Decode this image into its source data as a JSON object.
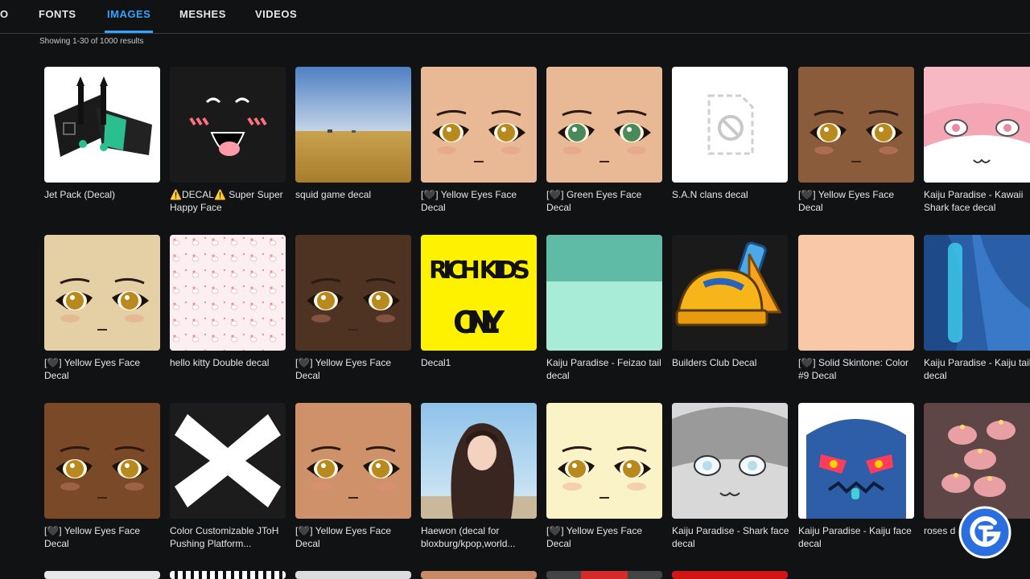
{
  "tabs": [
    {
      "label": "O",
      "active": false
    },
    {
      "label": "FONTS",
      "active": false
    },
    {
      "label": "IMAGES",
      "active": true
    },
    {
      "label": "MESHES",
      "active": false
    },
    {
      "label": "VIDEOS",
      "active": false
    }
  ],
  "results": {
    "count_text": "Showing 1-30 of 1000 results"
  },
  "rows": [
    [
      {
        "name": "Jet Pack (Decal)",
        "thumb": "jetpack-decal"
      },
      {
        "name": "⚠️DECAL⚠️ Super Super Happy Face",
        "thumb": "happy-face"
      },
      {
        "name": "squid game decal",
        "thumb": "wheat-field"
      },
      {
        "name": "[🖤] Yellow Eyes Face Decal",
        "thumb": "face-peach-yellow"
      },
      {
        "name": "[🖤] Green Eyes Face Decal",
        "thumb": "face-peach-green"
      },
      {
        "name": "S.A.N clans decal",
        "thumb": "unavailable"
      },
      {
        "name": "[🖤] Yellow Eyes Face Decal",
        "thumb": "face-brown-yellow"
      },
      {
        "name": "Kaiju Paradise - Kawaii Shark face decal",
        "thumb": "kawaii-shark"
      }
    ],
    [
      {
        "name": "[🖤] Yellow Eyes Face Decal",
        "thumb": "face-beige-yellow"
      },
      {
        "name": "hello kitty Double decal",
        "thumb": "hello-kitty-pattern"
      },
      {
        "name": "[🖤] Yellow Eyes Face Decal",
        "thumb": "face-dark-yellow"
      },
      {
        "name": "Decal1",
        "thumb": "rich-kids"
      },
      {
        "name": "Kaiju Paradise - Feizao tail decal",
        "thumb": "teal-split"
      },
      {
        "name": "Builders Club Decal",
        "thumb": "builders-club"
      },
      {
        "name": "[🖤] Solid Skintone: Color #9 Decal",
        "thumb": "solid-skintone"
      },
      {
        "name": "Kaiju Paradise - Kaiju tail decal",
        "thumb": "kaiju-tail"
      }
    ],
    [
      {
        "name": "[🖤] Yellow Eyes Face Decal",
        "thumb": "face-brown-yellow-2"
      },
      {
        "name": "Color Customizable JToH Pushing Platform...",
        "thumb": "white-x"
      },
      {
        "name": "[🖤] Yellow Eyes Face Decal",
        "thumb": "face-tan-yellow"
      },
      {
        "name": "Haewon (decal for bloxburg/kpop,world...",
        "thumb": "photo-portrait"
      },
      {
        "name": "[🖤] Yellow Eyes Face Decal",
        "thumb": "face-cream-yellow"
      },
      {
        "name": "Kaiju Paradise - Shark face decal",
        "thumb": "grey-shark"
      },
      {
        "name": "Kaiju Paradise - Kaiju face decal",
        "thumb": "blue-kaiju"
      },
      {
        "name": "roses d",
        "thumb": "rose-candles"
      }
    ]
  ],
  "colors": {
    "accent": "#33a3ff",
    "background": "#111214"
  },
  "logo": {
    "icon": "gamer-tweak-logo"
  }
}
